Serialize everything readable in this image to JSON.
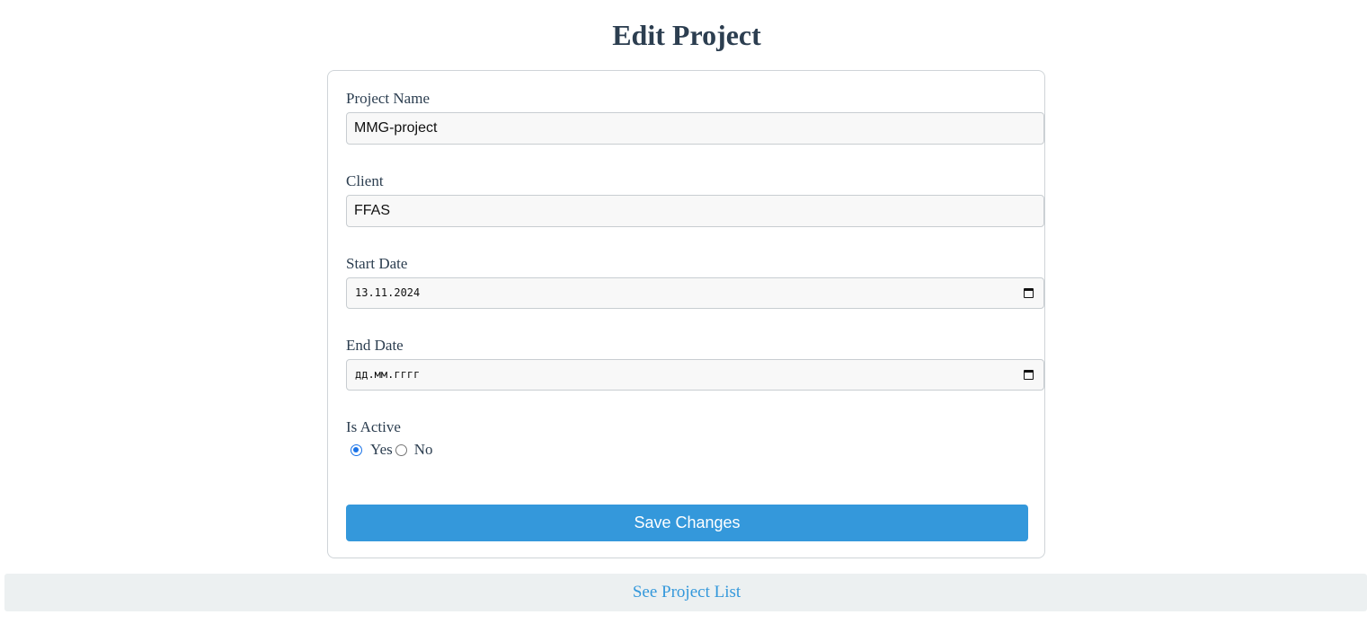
{
  "page": {
    "title": "Edit Project"
  },
  "form": {
    "project_name": {
      "label": "Project Name",
      "value": "MMG-project"
    },
    "client": {
      "label": "Client",
      "value": "FFAS"
    },
    "start_date": {
      "label": "Start Date",
      "value": "13.11.2024"
    },
    "end_date": {
      "label": "End Date",
      "value": "дд.мм.гггг"
    },
    "is_active": {
      "label": "Is Active",
      "options": [
        {
          "label": "Yes",
          "checked": true
        },
        {
          "label": "No",
          "checked": false
        }
      ]
    },
    "save_label": "Save Changes"
  },
  "footer": {
    "link_label": "See Project List"
  },
  "colors": {
    "accent": "#3498db",
    "text": "#2c3e50",
    "footer_bg": "#ecf0f1",
    "radio_checked": "#1a73e8"
  },
  "icons": {
    "date_picker": "calendar-icon"
  }
}
